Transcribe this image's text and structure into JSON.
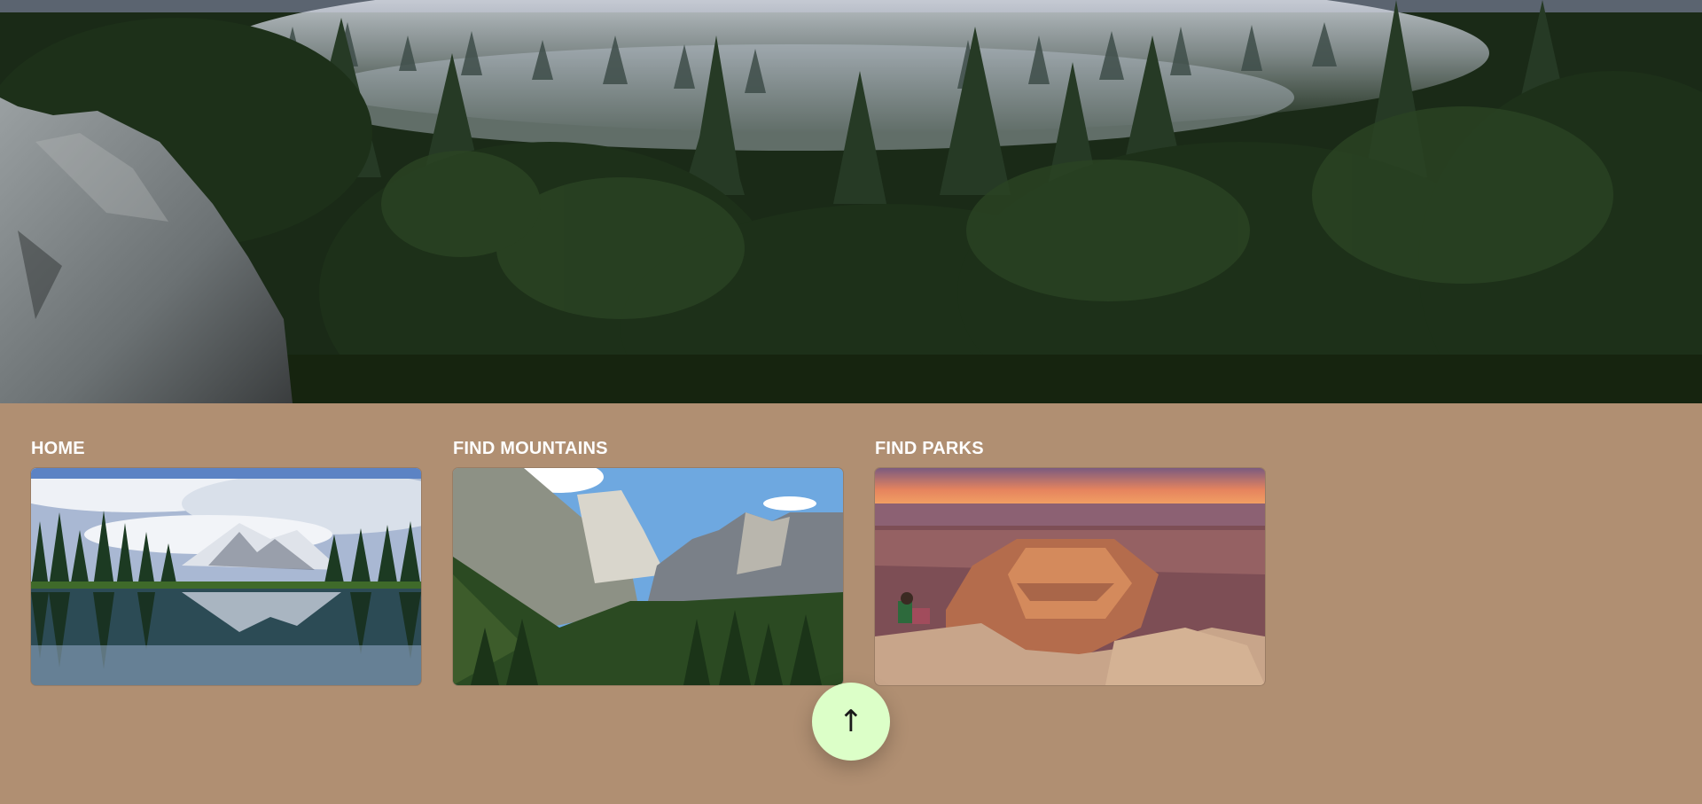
{
  "hero": {
    "alt": "misty pine forest with granite boulder"
  },
  "cards": [
    {
      "label": "HOME",
      "image": "mountain-lake-reflection"
    },
    {
      "label": "FIND MOUNTAINS",
      "image": "granite-valley"
    },
    {
      "label": "FIND PARKS",
      "image": "canyon-sunset"
    }
  ],
  "scroll_top": {
    "glyph": "↑",
    "icon": "arrow-up-icon"
  },
  "colors": {
    "page_bg": "#b08f72",
    "button_bg": "#dcffc8",
    "text": "#ffffff"
  }
}
